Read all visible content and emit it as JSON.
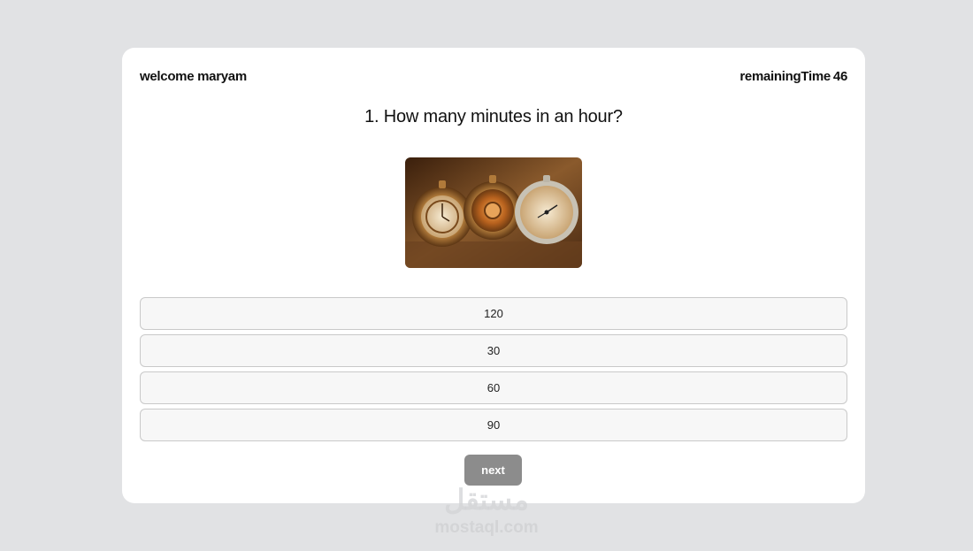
{
  "header": {
    "welcome": "welcome maryam",
    "timer_label": "remainingTime",
    "timer_value": "46"
  },
  "question": {
    "text": "1. How many minutes in an hour?",
    "image_icon": "pocket-watches-image"
  },
  "options": [
    "120",
    "30",
    "60",
    "90"
  ],
  "next_label": "next",
  "watermark": {
    "arabic": "مستقل",
    "latin": "mostaql.com"
  },
  "colors": {
    "background": "#e1e2e4",
    "card": "#ffffff",
    "option_bg": "#f7f7f7",
    "next_button": "#8c8c8c"
  }
}
